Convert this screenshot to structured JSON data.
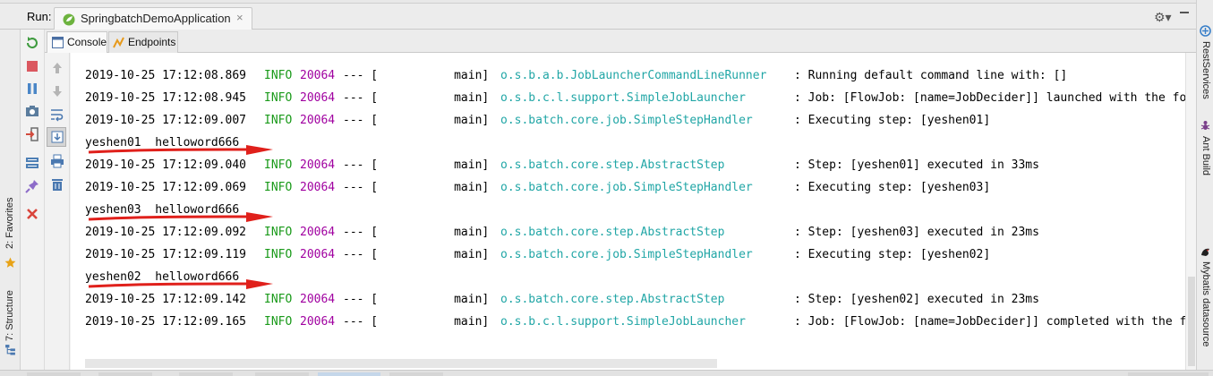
{
  "run_bar": {
    "label": "Run:",
    "tab_title": "SpringbatchDemoApplication",
    "close_glyph": "×",
    "settings_glyph": "⚙▾"
  },
  "sub_tabs": {
    "console": "Console",
    "endpoints": "Endpoints"
  },
  "left_strip": {
    "favorites": "2: Favorites",
    "structure": "7: Structure"
  },
  "right_strip": {
    "rest_services": "RestServices",
    "ant_build": "Ant Build",
    "mybatis": "Mybatis datasource"
  },
  "colors": {
    "info": "#1a9a1a",
    "pid": "#a000a0",
    "logger": "#21a6a6",
    "arrow": "#e0201b"
  },
  "console": {
    "lines": [
      {
        "time": "2019-10-25 17:12:08.869",
        "level": "INFO",
        "pid": "20064",
        "sep": "--- [",
        "thread": "           main]",
        "logger": "o.s.b.a.b.JobLauncherCommandLineRunner",
        "msg": ": Running default command line with: []"
      },
      {
        "time": "2019-10-25 17:12:08.945",
        "level": "INFO",
        "pid": "20064",
        "sep": "--- [",
        "thread": "           main]",
        "logger": "o.s.b.c.l.support.SimpleJobLauncher",
        "msg": ": Job: [FlowJob: [name=JobDecider]] launched with the fo"
      },
      {
        "time": "2019-10-25 17:12:09.007",
        "level": "INFO",
        "pid": "20064",
        "sep": "--- [",
        "thread": "           main]",
        "logger": "o.s.batch.core.job.SimpleStepHandler",
        "msg": ": Executing step: [yeshen01]"
      },
      {
        "plain": "yeshen01  helloword666"
      },
      {
        "time": "2019-10-25 17:12:09.040",
        "level": "INFO",
        "pid": "20064",
        "sep": "--- [",
        "thread": "           main]",
        "logger": "o.s.batch.core.step.AbstractStep",
        "msg": ": Step: [yeshen01] executed in 33ms"
      },
      {
        "time": "2019-10-25 17:12:09.069",
        "level": "INFO",
        "pid": "20064",
        "sep": "--- [",
        "thread": "           main]",
        "logger": "o.s.batch.core.job.SimpleStepHandler",
        "msg": ": Executing step: [yeshen03]"
      },
      {
        "plain": "yeshen03  helloword666"
      },
      {
        "time": "2019-10-25 17:12:09.092",
        "level": "INFO",
        "pid": "20064",
        "sep": "--- [",
        "thread": "           main]",
        "logger": "o.s.batch.core.step.AbstractStep",
        "msg": ": Step: [yeshen03] executed in 23ms"
      },
      {
        "time": "2019-10-25 17:12:09.119",
        "level": "INFO",
        "pid": "20064",
        "sep": "--- [",
        "thread": "           main]",
        "logger": "o.s.batch.core.job.SimpleStepHandler",
        "msg": ": Executing step: [yeshen02]"
      },
      {
        "plain": "yeshen02  helloword666"
      },
      {
        "time": "2019-10-25 17:12:09.142",
        "level": "INFO",
        "pid": "20064",
        "sep": "--- [",
        "thread": "           main]",
        "logger": "o.s.batch.core.step.AbstractStep",
        "msg": ": Step: [yeshen02] executed in 23ms"
      },
      {
        "time": "2019-10-25 17:12:09.165",
        "level": "INFO",
        "pid": "20064",
        "sep": "--- [",
        "thread": "           main]",
        "logger": "o.s.b.c.l.support.SimpleJobLauncher",
        "msg": ": Job: [FlowJob: [name=JobDecider]] completed with the f"
      }
    ]
  }
}
